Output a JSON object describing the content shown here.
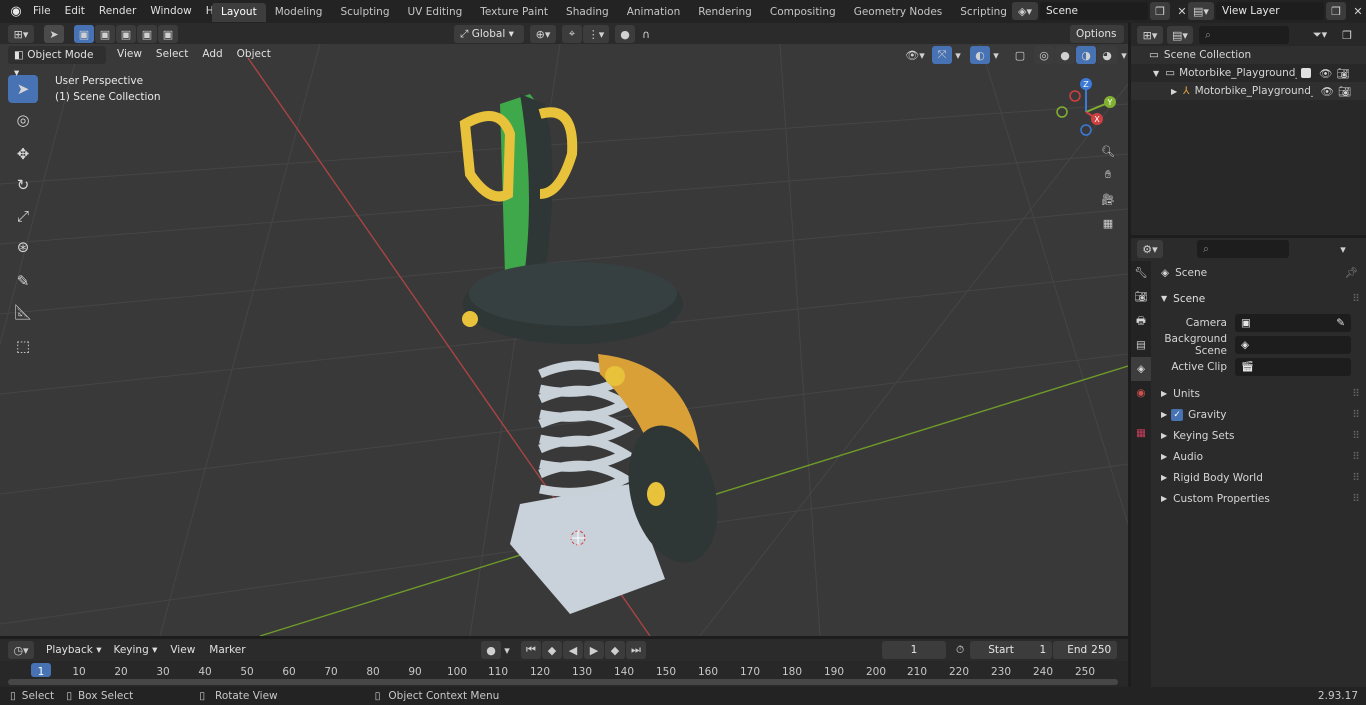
{
  "topbar": {
    "menu": [
      "File",
      "Edit",
      "Render",
      "Window",
      "Help"
    ],
    "workspaces": [
      "Layout",
      "Modeling",
      "Sculpting",
      "UV Editing",
      "Texture Paint",
      "Shading",
      "Animation",
      "Rendering",
      "Compositing",
      "Geometry Nodes",
      "Scripting"
    ],
    "add_workspace": "+",
    "scene_name": "Scene",
    "view_layer": "View Layer"
  },
  "viewport_header": {
    "mode": "Object Mode",
    "menus": [
      "View",
      "Select",
      "Add",
      "Object"
    ],
    "transform_orientation": "Global",
    "options": "Options"
  },
  "viewport": {
    "perspective_label": "User Perspective",
    "collection_label": "(1) Scene Collection",
    "gizmo_axes": [
      "X",
      "Y",
      "Z"
    ]
  },
  "outliner": {
    "scene_collection": "Scene Collection",
    "collection": "Motorbike_Playground_Spring",
    "object": "Motorbike_Playground_S"
  },
  "properties": {
    "context_title": "Scene",
    "panel": "Scene",
    "fields": [
      {
        "label": "Camera",
        "value": ""
      },
      {
        "label": "Background Scene",
        "value": ""
      },
      {
        "label": "Active Clip",
        "value": ""
      }
    ],
    "sections": [
      "Units",
      "Gravity",
      "Keying Sets",
      "Audio",
      "Rigid Body World",
      "Custom Properties"
    ],
    "gravity_checked": true
  },
  "timeline": {
    "menus": [
      "Playback",
      "Keying",
      "View",
      "Marker"
    ],
    "current_frame": "1",
    "start_label": "Start",
    "start": "1",
    "end_label": "End",
    "end": "250",
    "ticks": [
      "1",
      "10",
      "20",
      "30",
      "40",
      "50",
      "60",
      "70",
      "80",
      "90",
      "100",
      "110",
      "120",
      "130",
      "140",
      "150",
      "160",
      "170",
      "180",
      "190",
      "200",
      "210",
      "220",
      "230",
      "240",
      "250"
    ]
  },
  "statusbar": {
    "select": "Select",
    "box_select": "Box Select",
    "rotate_view": "Rotate View",
    "context_menu": "Object Context Menu",
    "version": "2.93.17"
  },
  "colors": {
    "accent": "#4772b3",
    "viewport_bg": "#393939",
    "grid_line": "#444444",
    "x_axis": "#b54545",
    "y_axis": "#7aa02a",
    "model_yellow": "#e8c23a",
    "model_green": "#3fa84a",
    "model_orange": "#d9a038",
    "model_dark": "#2e3636",
    "model_spring": "#c8d0d8"
  }
}
